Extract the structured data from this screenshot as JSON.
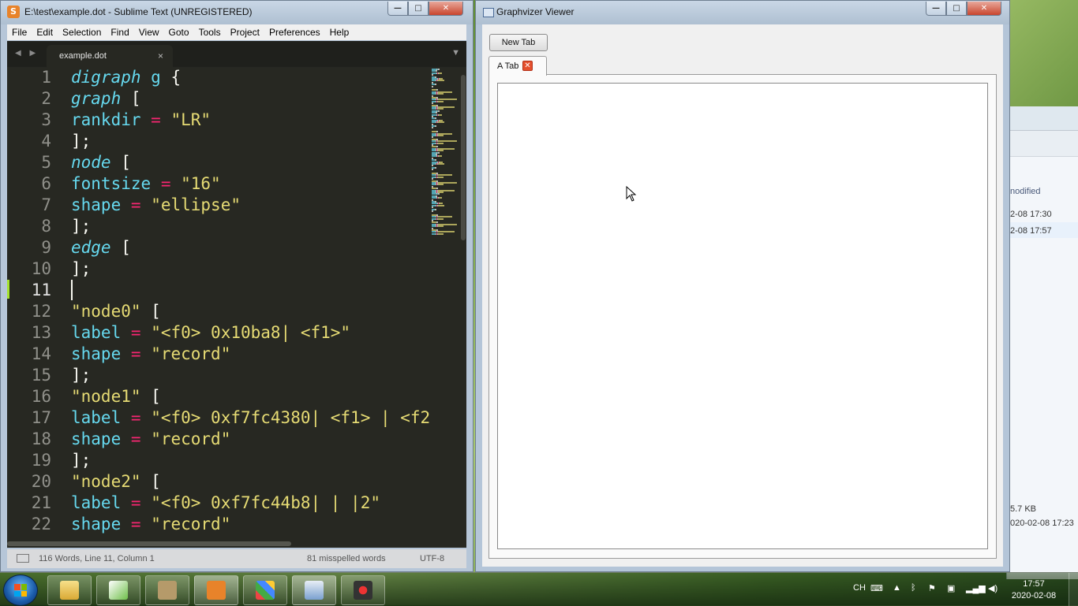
{
  "background_window": {
    "column_header": "nodified",
    "rows": [
      "2-08 17:30",
      "2-08 17:57"
    ],
    "details": [
      "5.7 KB",
      "020-02-08 17:23"
    ]
  },
  "sublime": {
    "title": "E:\\test\\example.dot - Sublime Text (UNREGISTERED)",
    "icon_letter": "S",
    "window_buttons": [
      "—",
      "□",
      "✕"
    ],
    "menu": [
      "File",
      "Edit",
      "Selection",
      "Find",
      "View",
      "Goto",
      "Tools",
      "Project",
      "Preferences",
      "Help"
    ],
    "tab": {
      "label": "example.dot",
      "close": "×"
    },
    "nav_arrows": "◀ ▶",
    "dropdown": "▼",
    "active_line": 11,
    "lines": [
      [
        [
          "kw",
          "digraph"
        ],
        [
          "plain",
          " "
        ],
        [
          "attr",
          "g"
        ],
        [
          "plain",
          " {"
        ]
      ],
      [
        [
          "kw",
          "graph"
        ],
        [
          "plain",
          " ["
        ]
      ],
      [
        [
          "attr",
          "rankdir"
        ],
        [
          "plain",
          " "
        ],
        [
          "op",
          "="
        ],
        [
          "plain",
          " "
        ],
        [
          "str",
          "\"LR\""
        ]
      ],
      [
        [
          "plain",
          "];"
        ]
      ],
      [
        [
          "kw",
          "node"
        ],
        [
          "plain",
          " ["
        ]
      ],
      [
        [
          "attr",
          "fontsize"
        ],
        [
          "plain",
          " "
        ],
        [
          "op",
          "="
        ],
        [
          "plain",
          " "
        ],
        [
          "str",
          "\"16\""
        ]
      ],
      [
        [
          "attr",
          "shape"
        ],
        [
          "plain",
          " "
        ],
        [
          "op",
          "="
        ],
        [
          "plain",
          " "
        ],
        [
          "str",
          "\"ellipse\""
        ]
      ],
      [
        [
          "plain",
          "];"
        ]
      ],
      [
        [
          "kw",
          "edge"
        ],
        [
          "plain",
          " ["
        ]
      ],
      [
        [
          "plain",
          "];"
        ]
      ],
      [],
      [
        [
          "str",
          "\"node0\""
        ],
        [
          "plain",
          " ["
        ]
      ],
      [
        [
          "attr",
          "label"
        ],
        [
          "plain",
          " "
        ],
        [
          "op",
          "="
        ],
        [
          "plain",
          " "
        ],
        [
          "str",
          "\"<f0> 0x10ba8| <f1>\""
        ]
      ],
      [
        [
          "attr",
          "shape"
        ],
        [
          "plain",
          " "
        ],
        [
          "op",
          "="
        ],
        [
          "plain",
          " "
        ],
        [
          "str",
          "\"record\""
        ]
      ],
      [
        [
          "plain",
          "];"
        ]
      ],
      [
        [
          "str",
          "\"node1\""
        ],
        [
          "plain",
          " ["
        ]
      ],
      [
        [
          "attr",
          "label"
        ],
        [
          "plain",
          " "
        ],
        [
          "op",
          "="
        ],
        [
          "plain",
          " "
        ],
        [
          "str",
          "\"<f0> 0xf7fc4380| <f1> | <f2"
        ]
      ],
      [
        [
          "attr",
          "shape"
        ],
        [
          "plain",
          " "
        ],
        [
          "op",
          "="
        ],
        [
          "plain",
          " "
        ],
        [
          "str",
          "\"record\""
        ]
      ],
      [
        [
          "plain",
          "];"
        ]
      ],
      [
        [
          "str",
          "\"node2\""
        ],
        [
          "plain",
          " ["
        ]
      ],
      [
        [
          "attr",
          "label"
        ],
        [
          "plain",
          " "
        ],
        [
          "op",
          "="
        ],
        [
          "plain",
          " "
        ],
        [
          "str",
          "\"<f0> 0xf7fc44b8| | |2\""
        ]
      ],
      [
        [
          "attr",
          "shape"
        ],
        [
          "plain",
          " "
        ],
        [
          "op",
          "="
        ],
        [
          "plain",
          " "
        ],
        [
          "str",
          "\"record\""
        ]
      ]
    ],
    "status": {
      "position": "116 Words, Line 11, Column 1",
      "spelling": "81 misspelled words",
      "encoding": "UTF-8"
    }
  },
  "graphvizer": {
    "title": "Graphvizer Viewer",
    "new_tab_button": "New Tab",
    "tab_label": "A Tab",
    "tab_close": "✕"
  },
  "taskbar": {
    "language": "CH",
    "time": "17:57",
    "date": "2020-02-08",
    "apps": [
      "file-explorer",
      "graphviz-editor",
      "tool",
      "sublime-text",
      "app-tiles",
      "viewer",
      "media-recorder"
    ]
  },
  "colors": {
    "editor_bg": "#272822",
    "keyword": "#66d9ef",
    "operator": "#f92672",
    "string": "#e6db74",
    "text": "#f8f8f2",
    "active_line_marker": "#a6e22e"
  }
}
